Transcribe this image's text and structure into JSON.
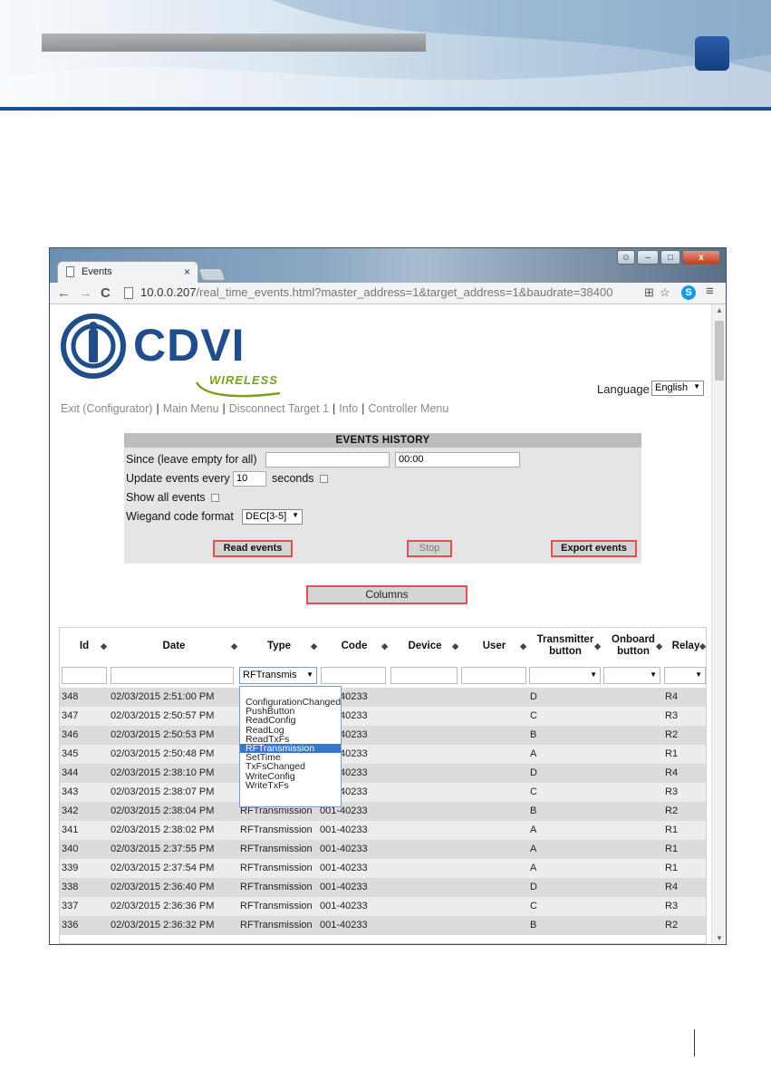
{
  "browser": {
    "tab_title": "Events",
    "tab_close": "×",
    "url_host": "10.0.0.207",
    "url_path": "/real_time_events.html?master_address=1&target_address=1&baudrate=38400",
    "skype_label": "S",
    "window_buttons": {
      "minimize": "–",
      "maximize": "□",
      "close": "x"
    },
    "nav": {
      "back": "←",
      "forward": "→",
      "reload": "C"
    }
  },
  "logo": {
    "brand": "CDVI",
    "tagline": "WIRELESS"
  },
  "language": {
    "label": "Language",
    "selected": "English"
  },
  "menu": {
    "items": [
      "Exit (Configurator)",
      "Main Menu",
      "Disconnect Target 1",
      "Info",
      "Controller Menu"
    ],
    "separator": "|"
  },
  "history": {
    "title": "EVENTS HISTORY",
    "since_label": "Since (leave empty for all)",
    "since_date": "",
    "since_time": "00:00",
    "update_label": "Update events every",
    "update_value": "10",
    "seconds_label": "seconds",
    "show_all_label": "Show all events",
    "wiegand_label": "Wiegand code format",
    "wiegand_value": "DEC[3-5]",
    "read_button": "Read events",
    "stop_button": "Stop",
    "export_button": "Export events"
  },
  "columns_button": "Columns",
  "table": {
    "headers": {
      "id": "Id",
      "date": "Date",
      "type": "Type",
      "code": "Code",
      "device": "Device",
      "user": "User",
      "transmitter_1": "Transmitter",
      "transmitter_2": "button",
      "onboard_1": "Onboard",
      "onboard_2": "button",
      "relay": "Relay"
    },
    "sort_glyph": "◆",
    "type_filter_value": "RFTransmis",
    "type_options": [
      "ConfigurationChanged",
      "PushButton",
      "ReadConfig",
      "ReadLog",
      "ReadTxFs",
      "RFTransmission",
      "SetTime",
      "TxFsChanged",
      "WriteConfig",
      "WriteTxFs"
    ],
    "selected_type_option": "RFTransmission",
    "rows": [
      {
        "id": "348",
        "date": "02/03/2015 2:51:00 PM",
        "type": "RFTransmission",
        "code": "001-40233",
        "button": "D",
        "relay": "R4"
      },
      {
        "id": "347",
        "date": "02/03/2015 2:50:57 PM",
        "type": "RFTransmission",
        "code": "001-40233",
        "button": "C",
        "relay": "R3"
      },
      {
        "id": "346",
        "date": "02/03/2015 2:50:53 PM",
        "type": "RFTransmission",
        "code": "001-40233",
        "button": "B",
        "relay": "R2"
      },
      {
        "id": "345",
        "date": "02/03/2015 2:50:48 PM",
        "type": "RFTransmission",
        "code": "001-40233",
        "button": "A",
        "relay": "R1"
      },
      {
        "id": "344",
        "date": "02/03/2015 2:38:10 PM",
        "type": "RFTransmission",
        "code": "001-40233",
        "button": "D",
        "relay": "R4"
      },
      {
        "id": "343",
        "date": "02/03/2015 2:38:07 PM",
        "type": "RFTransmission",
        "code": "001-40233",
        "button": "C",
        "relay": "R3"
      },
      {
        "id": "342",
        "date": "02/03/2015 2:38:04 PM",
        "type": "RFTransmission",
        "code": "001-40233",
        "button": "B",
        "relay": "R2"
      },
      {
        "id": "341",
        "date": "02/03/2015 2:38:02 PM",
        "type": "RFTransmission",
        "code": "001-40233",
        "button": "A",
        "relay": "R1"
      },
      {
        "id": "340",
        "date": "02/03/2015 2:37:55 PM",
        "type": "RFTransmission",
        "code": "001-40233",
        "button": "A",
        "relay": "R1"
      },
      {
        "id": "339",
        "date": "02/03/2015 2:37:54 PM",
        "type": "RFTransmission",
        "code": "001-40233",
        "button": "A",
        "relay": "R1"
      },
      {
        "id": "338",
        "date": "02/03/2015 2:36:40 PM",
        "type": "RFTransmission",
        "code": "001-40233",
        "button": "D",
        "relay": "R4"
      },
      {
        "id": "337",
        "date": "02/03/2015 2:36:36 PM",
        "type": "RFTransmission",
        "code": "001-40233",
        "button": "C",
        "relay": "R3"
      },
      {
        "id": "336",
        "date": "02/03/2015 2:36:32 PM",
        "type": "RFTransmission",
        "code": "001-40233",
        "button": "B",
        "relay": "R2"
      }
    ]
  },
  "colors": {
    "brand_blue": "#1f4e8a",
    "tagline_green": "#7aa11a",
    "button_border": "#e05050",
    "dropdown_highlight": "#3875d7"
  }
}
